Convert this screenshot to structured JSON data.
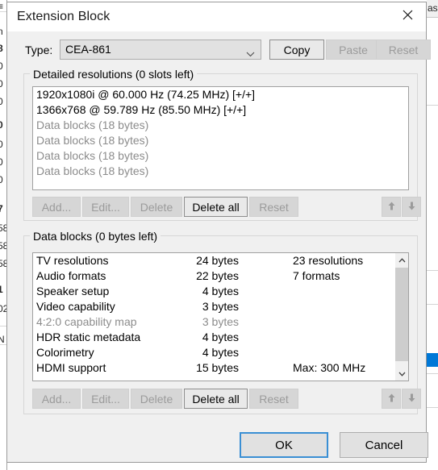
{
  "window": {
    "title": "Extension Block",
    "close_icon": "close-icon"
  },
  "type_row": {
    "label": "Type:",
    "value": "CEA-861",
    "dropdown_icon": "chevron-down-icon",
    "copy_label": "Copy",
    "paste_label": "Paste",
    "reset_label": "Reset"
  },
  "detailed_resolutions": {
    "group_title": "Detailed resolutions (0 slots left)",
    "items": [
      {
        "text": "1920x1080i @ 60.000 Hz (74.25 MHz) [+/+]",
        "dim": false
      },
      {
        "text": "1366x768 @ 59.789 Hz (85.50 MHz) [+/+]",
        "dim": false
      },
      {
        "text": "Data blocks (18 bytes)",
        "dim": true
      },
      {
        "text": "Data blocks (18 bytes)",
        "dim": true
      },
      {
        "text": "Data blocks (18 bytes)",
        "dim": true
      },
      {
        "text": "Data blocks (18 bytes)",
        "dim": true
      }
    ],
    "buttons": {
      "add": "Add...",
      "edit": "Edit...",
      "delete": "Delete",
      "delete_all": "Delete all",
      "reset": "Reset",
      "move_up_icon": "arrow-up-icon",
      "move_down_icon": "arrow-down-icon"
    }
  },
  "data_blocks": {
    "group_title": "Data blocks (0 bytes left)",
    "rows": [
      {
        "name": "TV resolutions",
        "bytes": "24 bytes",
        "extra": "23 resolutions",
        "dim": false
      },
      {
        "name": "Audio formats",
        "bytes": "22 bytes",
        "extra": "7 formats",
        "dim": false
      },
      {
        "name": "Speaker setup",
        "bytes": "4 bytes",
        "extra": "",
        "dim": false
      },
      {
        "name": "Video capability",
        "bytes": "3 bytes",
        "extra": "",
        "dim": false
      },
      {
        "name": "4:2:0 capability map",
        "bytes": "3 bytes",
        "extra": "",
        "dim": true
      },
      {
        "name": "HDR static metadata",
        "bytes": "4 bytes",
        "extra": "",
        "dim": false
      },
      {
        "name": "Colorimetry",
        "bytes": "4 bytes",
        "extra": "",
        "dim": false
      },
      {
        "name": "HDMI support",
        "bytes": "15 bytes",
        "extra": "Max: 300 MHz",
        "dim": false
      }
    ],
    "scrollbar": {
      "up_icon": "scroll-up-icon",
      "down_icon": "scroll-down-icon"
    },
    "buttons": {
      "add": "Add...",
      "edit": "Edit...",
      "delete": "Delete",
      "delete_all": "Delete all",
      "reset": "Reset",
      "move_up_icon": "arrow-up-icon",
      "move_down_icon": "arrow-down-icon"
    }
  },
  "footer": {
    "ok_label": "OK",
    "cancel_label": "Cancel"
  },
  "colors": {
    "dialog_background": "#f0f0f0",
    "list_background": "#ffffff",
    "disabled_text": "#9b9b9b",
    "focus_border": "#3a8fd4",
    "selection_blue": "#0078d7"
  }
}
